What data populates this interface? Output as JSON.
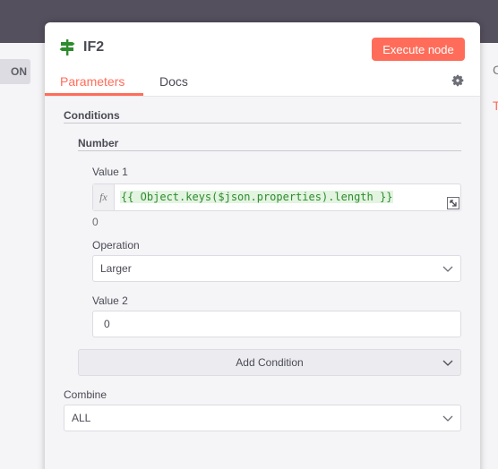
{
  "backdrop": {
    "left_pill_label": "ON",
    "right_peek_top": "C",
    "right_peek_tab": "T"
  },
  "node": {
    "title": "IF2",
    "execute_label": "Execute node",
    "icon": "signpost-icon"
  },
  "tabs": [
    {
      "label": "Parameters",
      "active": true
    },
    {
      "label": "Docs",
      "active": false
    }
  ],
  "settings_icon": "gear-icon",
  "conditions": {
    "title": "Conditions",
    "group_title": "Number",
    "value1": {
      "label": "Value 1",
      "fx": "fx",
      "expression": "{{ Object.keys($json.properties).length }}",
      "result": "0"
    },
    "operation": {
      "label": "Operation",
      "value": "Larger"
    },
    "value2": {
      "label": "Value 2",
      "value": "0"
    },
    "add_condition_label": "Add Condition"
  },
  "combine": {
    "label": "Combine",
    "value": "ALL"
  },
  "colors": {
    "accent": "#ff6d5a",
    "node_icon": "#2e8b2e",
    "expression_bg": "#e3f4e1"
  }
}
